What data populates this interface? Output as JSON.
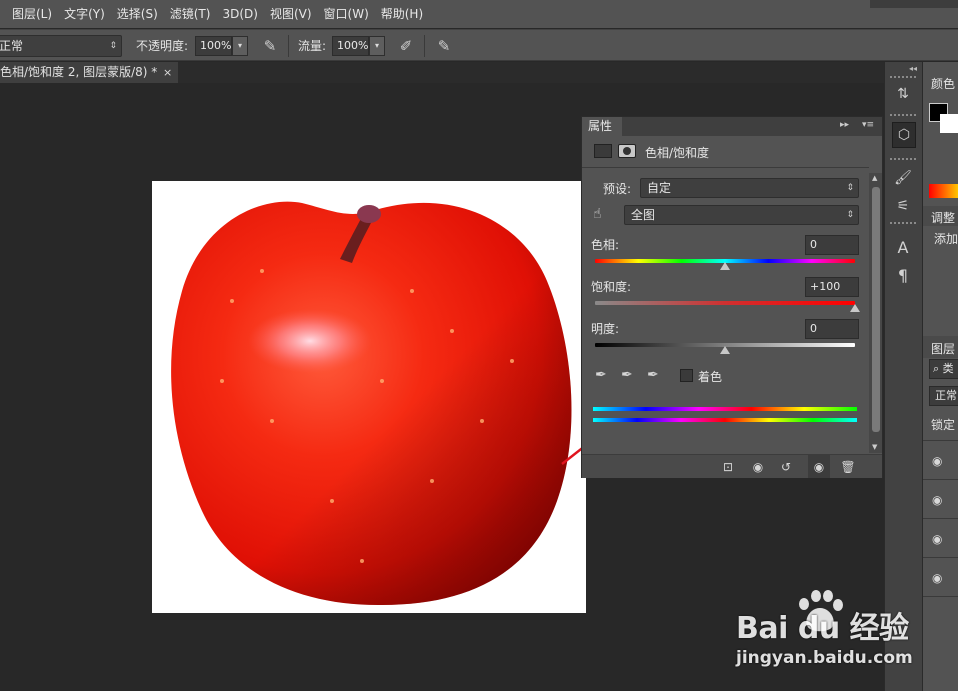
{
  "menu": [
    "图层(L)",
    "文字(Y)",
    "选择(S)",
    "滤镜(T)",
    "3D(D)",
    "视图(V)",
    "窗口(W)",
    "帮助(H)"
  ],
  "options": {
    "blend_mode": "正常",
    "opacity_label": "不透明度:",
    "opacity_value": "100%",
    "flow_label": "流量:",
    "flow_value": "100%"
  },
  "document_tab": {
    "title": "色相/饱和度 2, 图层蒙版/8) *",
    "close": "×"
  },
  "properties": {
    "tab_label": "属性",
    "panel_title": "色相/饱和度",
    "collapse_glyph": "▸▸",
    "menu_glyph": "▾≡",
    "preset_label": "预设:",
    "preset_value": "自定",
    "channel_value": "全图",
    "hue": {
      "label": "色相:",
      "value": "0",
      "level": 0.5
    },
    "saturation": {
      "label": "饱和度:",
      "value": "+100",
      "level": 1.0
    },
    "lightness": {
      "label": "明度:",
      "value": "0",
      "level": 0.5
    },
    "colorize_label": "着色"
  },
  "right_panels": {
    "color_tab": "颜色",
    "adjust_tab": "调整",
    "adjust_add": "添加",
    "layers_tab": "图层",
    "layers_search": "类",
    "layers_blend": "正常",
    "layers_lock": "锁定"
  },
  "watermark": {
    "logo_text": "Bai du 经验",
    "url": "jingyan.baidu.com"
  },
  "colors": {
    "menu_bg": "#535353",
    "canvas_bg": "#282828",
    "arrow": "#e0141e"
  }
}
